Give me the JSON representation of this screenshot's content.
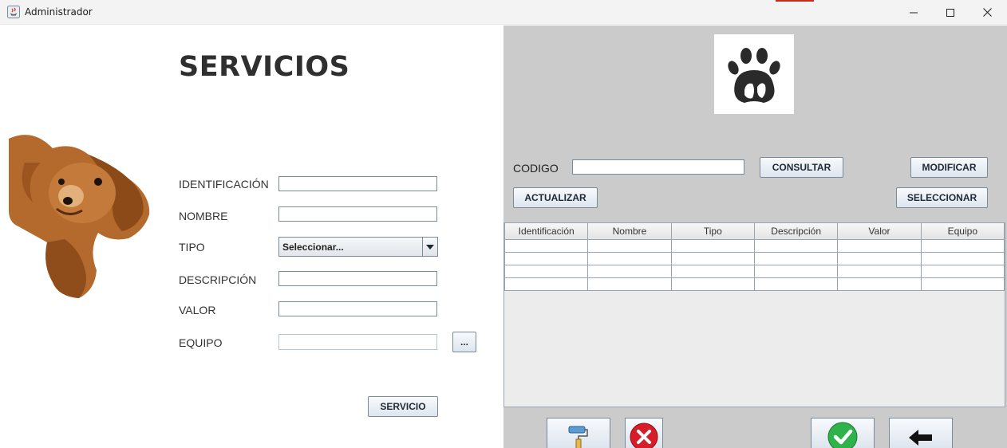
{
  "window": {
    "title": "Administrador",
    "controls": [
      "minimize",
      "maximize",
      "close"
    ]
  },
  "form": {
    "heading": "SERVICIOS",
    "labels": {
      "identificacion": "IDENTIFICACIÓN",
      "nombre": "NOMBRE",
      "tipo": "TIPO",
      "descripcion": "DESCRIPCIÓN",
      "valor": "VALOR",
      "equipo": "EQUIPO"
    },
    "values": {
      "identificacion": "",
      "nombre": "",
      "descripcion": "",
      "valor": "",
      "equipo": ""
    },
    "tipo_selected": "Seleccionar...",
    "equipo_browse_label": "...",
    "servicio_button": "SERVICIO"
  },
  "search": {
    "codigo_label": "CODIGO",
    "codigo_value": "",
    "consultar": "CONSULTAR",
    "modificar": "MODIFICAR",
    "actualizar": "ACTUALIZAR",
    "seleccionar": "SELECCIONAR"
  },
  "table": {
    "columns": [
      "Identificación",
      "Nombre",
      "Tipo",
      "Descripción",
      "Valor",
      "Equipo"
    ],
    "rows": [
      [
        "",
        "",
        "",
        "",
        "",
        ""
      ],
      [
        "",
        "",
        "",
        "",
        "",
        ""
      ],
      [
        "",
        "",
        "",
        "",
        "",
        ""
      ],
      [
        "",
        "",
        "",
        "",
        "",
        ""
      ]
    ]
  },
  "bottom_buttons": [
    "paint-roller-icon",
    "cancel-icon",
    "confirm-icon",
    "back-arrow-icon"
  ],
  "colors": {
    "right_panel_bg": "#cbcbcb",
    "table_area_bg": "#ececec",
    "button_gradient_top": "#f8fafc",
    "button_gradient_bottom": "#dde5ee",
    "cancel_red": "#d71e28",
    "confirm_green": "#2eb24a"
  }
}
